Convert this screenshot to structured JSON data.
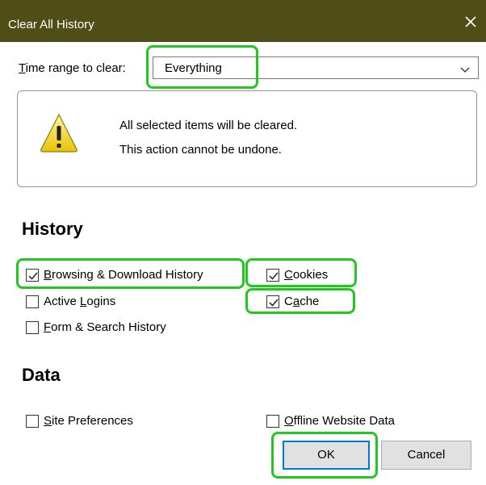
{
  "dialog": {
    "title": "Clear All History"
  },
  "time_range": {
    "label_accel": "T",
    "label_rest": "ime range to clear:",
    "selected": "Everything"
  },
  "warning": {
    "line1": "All selected items will be cleared.",
    "line2": "This action cannot be undone."
  },
  "history": {
    "heading": "History",
    "items": [
      {
        "pre": "",
        "accel": "B",
        "post": "rowsing & Download History",
        "checked": true
      },
      {
        "pre": "",
        "accel": "C",
        "post": "ookies",
        "checked": true
      },
      {
        "pre": "Active ",
        "accel": "L",
        "post": "ogins",
        "checked": false
      },
      {
        "pre": "C",
        "accel": "a",
        "post": "che",
        "checked": true
      },
      {
        "pre": "",
        "accel": "F",
        "post": "orm & Search History",
        "checked": false
      }
    ]
  },
  "data": {
    "heading": "Data",
    "items": [
      {
        "pre": "",
        "accel": "S",
        "post": "ite Preferences",
        "checked": false
      },
      {
        "pre": "",
        "accel": "O",
        "post": "ffline Website Data",
        "checked": false
      }
    ]
  },
  "buttons": {
    "ok": "OK",
    "cancel": "Cancel"
  },
  "colors": {
    "titlebar": "#4e4e16",
    "highlight": "#22c81e",
    "focus": "#0078d7"
  }
}
